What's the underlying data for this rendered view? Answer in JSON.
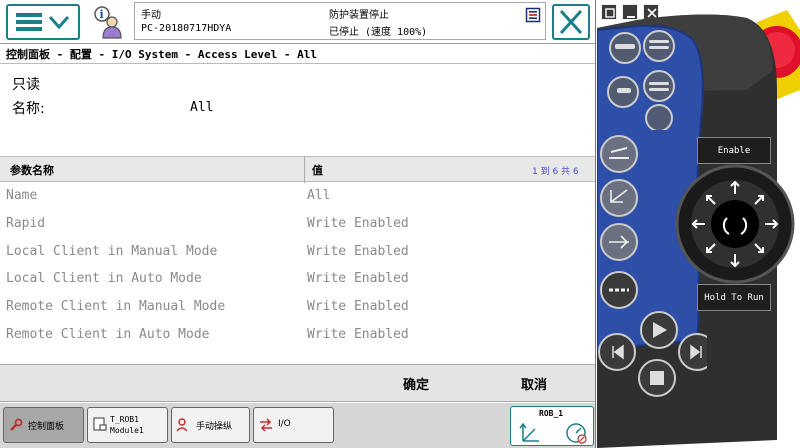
{
  "topbar": {
    "mode": "手动",
    "controller_name": "PC-20180717HDYA",
    "guard_status": "防护装置停止",
    "run_status": "已停止 (速度 100%)"
  },
  "breadcrumb": "控制面板 - 配置 - I/O System - Access Level - All",
  "detail": {
    "readonly_label": "只读",
    "name_label": "名称:",
    "name_value": "All"
  },
  "table": {
    "header_name": "参数名称",
    "header_value": "值",
    "page_counter": "1 到 6 共 6",
    "rows": [
      {
        "name": "Name",
        "value": "All"
      },
      {
        "name": "Rapid",
        "value": "Write Enabled"
      },
      {
        "name": "Local Client in Manual Mode",
        "value": "Write Enabled"
      },
      {
        "name": "Local Client in Auto Mode",
        "value": "Write Enabled"
      },
      {
        "name": "Remote Client in Manual Mode",
        "value": "Write Enabled"
      },
      {
        "name": "Remote Client in Auto Mode",
        "value": "Write Enabled"
      }
    ]
  },
  "actions": {
    "ok_label": "确定",
    "cancel_label": "取消"
  },
  "taskbar": {
    "control_panel": "控制面板",
    "module_line1": "T_ROB1",
    "module_line2": "Module1",
    "jogging": "手动操纵",
    "io": "I/O",
    "quickset_label": "ROB_1"
  },
  "pendant": {
    "enable_label": "Enable",
    "hold_label": "Hold To Run"
  },
  "colors": {
    "accent": "#1b7f88",
    "pendant_body": "#2f2f2f",
    "pendant_blue": "#2d4fa8",
    "emergency_stop": "#e0102a"
  },
  "icons": {
    "menu": "hamburger-chevron-icon",
    "info": "info-person-icon",
    "status": "status-document-icon",
    "close": "close-x-icon"
  }
}
